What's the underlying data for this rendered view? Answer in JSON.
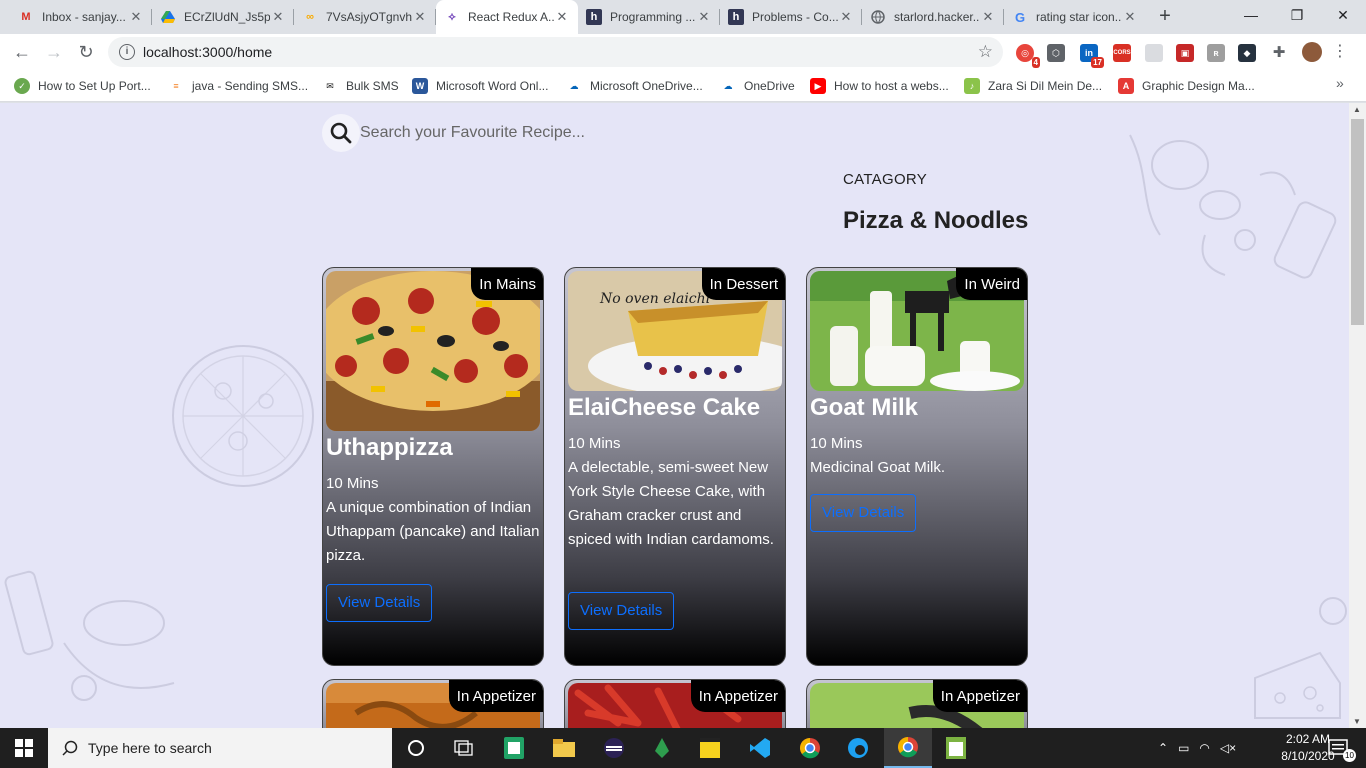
{
  "browser": {
    "tabs": [
      {
        "title": "Inbox - sanjay...",
        "icon": "gmail-icon",
        "color": "#d93025"
      },
      {
        "title": "ECrZlUdN_Js5p...",
        "icon": "drive-icon",
        "color": "#1a73e8"
      },
      {
        "title": "7VsAsjyOTgnvh...",
        "icon": "colab-icon",
        "color": "#f9ab00"
      },
      {
        "title": "React Redux A...",
        "icon": "redux-icon",
        "color": "#764abc"
      },
      {
        "title": "Programming ...",
        "icon": "hackerearth-icon",
        "color": "#323754"
      },
      {
        "title": "Problems - Co...",
        "icon": "hackerearth-icon",
        "color": "#323754"
      },
      {
        "title": "starlord.hacker...",
        "icon": "globe-icon",
        "color": "#5f6368"
      },
      {
        "title": "rating star icon...",
        "icon": "google-icon",
        "color": "#4285f4"
      }
    ],
    "url": "localhost:3000/home",
    "extension_badges": [
      "4",
      "17",
      "CORS"
    ],
    "bookmarks": [
      {
        "label": "How to Set Up Port...",
        "color": "#6aa84f"
      },
      {
        "label": "java - Sending SMS...",
        "color": "#f48024"
      },
      {
        "label": "Bulk SMS",
        "color": "#222222"
      },
      {
        "label": "Microsoft Word Onl...",
        "color": "#2b579a"
      },
      {
        "label": "Microsoft OneDrive...",
        "color": "#0364b8"
      },
      {
        "label": "OneDrive",
        "color": "#0364b8"
      },
      {
        "label": "How to host a webs...",
        "color": "#ff0000"
      },
      {
        "label": "Zara Si Dil Mein De...",
        "color": "#8bc34a"
      },
      {
        "label": "Graphic Design Ma...",
        "color": "#e53935"
      }
    ]
  },
  "page": {
    "search_placeholder": "Search your Favourite Recipe...",
    "category_label": "CATAGORY",
    "category_title": "Pizza & Noodles",
    "view_details_label": "View Details",
    "cards": [
      {
        "name": "Uthappizza",
        "tag": "In Mains",
        "time": "10 Mins",
        "description": "A unique combination of Indian Uthappam (pancake) and Italian pizza."
      },
      {
        "name": "ElaiCheese Cake",
        "tag": "In Dessert",
        "time": "10 Mins",
        "description": "A delectable, semi-sweet New York Style Cheese Cake, with Graham cracker crust and spiced with Indian cardamoms.",
        "image_caption": "No oven elaichi"
      },
      {
        "name": "Goat Milk",
        "tag": "In Weird",
        "time": "10 Mins",
        "description": "Medicinal Goat Milk."
      },
      {
        "tag": "In Appetizer"
      },
      {
        "tag": "In Appetizer"
      },
      {
        "tag": "In Appetizer"
      }
    ]
  },
  "taskbar": {
    "search_placeholder": "Type here to search",
    "time": "2:02 AM",
    "date": "8/10/2020",
    "notifications": "10"
  }
}
